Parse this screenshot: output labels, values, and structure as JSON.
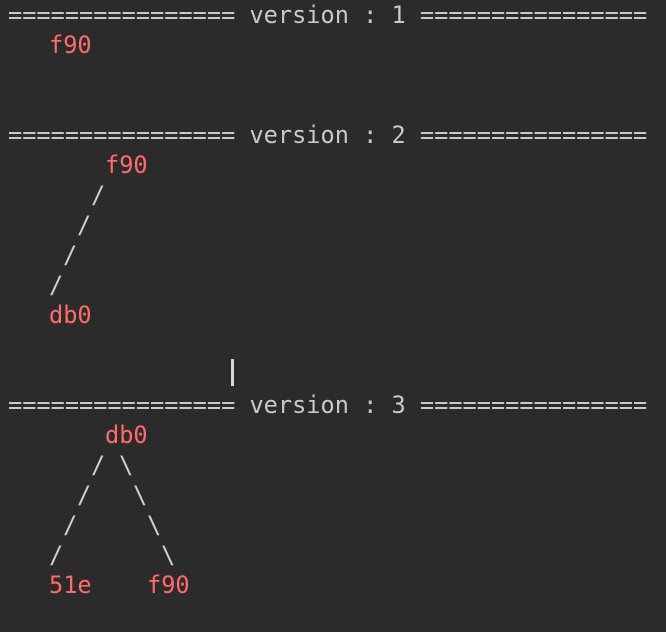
{
  "terminal": {
    "version1": {
      "header": "================ version : 1 ================",
      "root": "f90"
    },
    "version2": {
      "header": "================ version : 2 ================",
      "root": "f90",
      "edges": [
        "/",
        "/",
        "/",
        "/"
      ],
      "leaf": "db0"
    },
    "version3": {
      "header": "================ version : 3 ================",
      "root": "db0",
      "left_edges": [
        "/",
        "/",
        "/",
        "/"
      ],
      "right_edges": [
        "\\",
        "\\",
        "\\",
        "\\"
      ],
      "left_leaf": "51e",
      "right_leaf": "f90"
    }
  }
}
